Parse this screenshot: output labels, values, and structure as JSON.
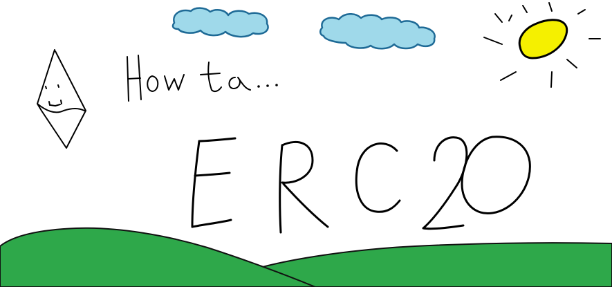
{
  "drawing": {
    "caption": "How to...",
    "headline": "ERC20"
  },
  "colors": {
    "background": "#ffffff",
    "cloud_fill": "#9fd9ea",
    "cloud_outline": "#1e6a96",
    "sun_fill": "#f5f000",
    "hill_fill": "#2ea84a",
    "ink": "#000000"
  },
  "icons": {
    "mascot": "ethereum-diamond-icon",
    "sun": "sun-icon",
    "clouds": "cloud-icon"
  }
}
